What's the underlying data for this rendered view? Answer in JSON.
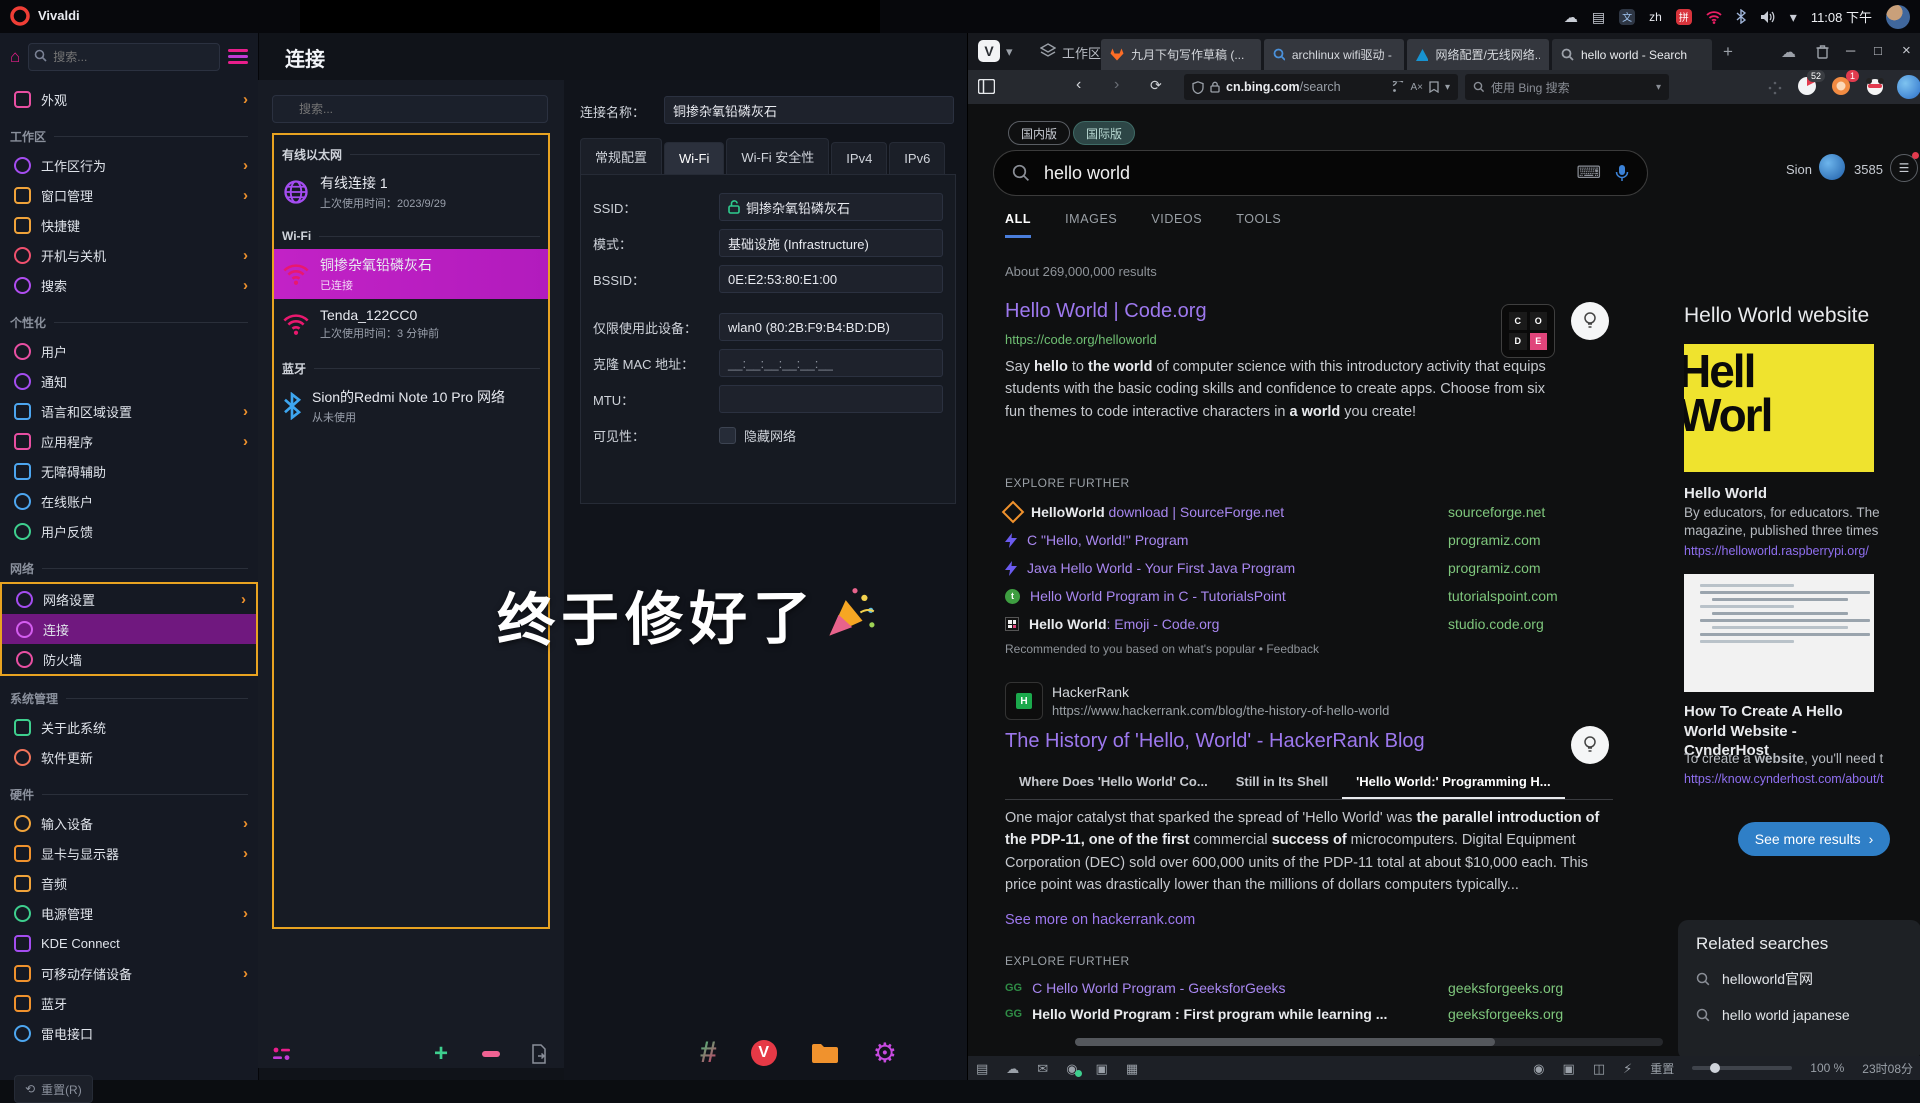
{
  "icons": {
    "chevron": "›",
    "plus": "+",
    "close": "×",
    "maximize": "□",
    "minimize": "─",
    "dropdown": "▾",
    "back": "‹",
    "forward": "›",
    "reload": "⟳",
    "menu": "☰",
    "undo": "⟲",
    "hash": "#",
    "gear": "⚙",
    "keyboard": "⌨",
    "newtab": "+",
    "home": "⌂",
    "mail": "✉",
    "cloud": "☁",
    "panel": "▤",
    "image": "▣",
    "calendar": "▦",
    "tile": "◫",
    "lightning": "⚡",
    "camera": "◉",
    "translate": "A×"
  },
  "topbar": {
    "app_title": "Vivaldi",
    "lang_indicator": "zh",
    "clock": "11:08 下午",
    "ime_badge": "拼",
    "dict_badge": "文"
  },
  "overlay": {
    "text": "终于修好了"
  },
  "settings": {
    "title": "连接",
    "search_placeholder": "搜索...",
    "sidebar": {
      "top": {
        "label": "外观"
      },
      "groups": [
        {
          "title": "工作区",
          "items": [
            {
              "label": "工作区行为"
            },
            {
              "label": "窗口管理"
            },
            {
              "label": "快捷键"
            },
            {
              "label": "开机与关机"
            },
            {
              "label": "搜索"
            }
          ]
        },
        {
          "title": "个性化",
          "items": [
            {
              "label": "用户"
            },
            {
              "label": "通知"
            },
            {
              "label": "语言和区域设置"
            },
            {
              "label": "应用程序"
            },
            {
              "label": "无障碍辅助"
            },
            {
              "label": "在线账户"
            },
            {
              "label": "用户反馈"
            }
          ]
        },
        {
          "title": "网络",
          "items": [
            {
              "label": "网络设置"
            },
            {
              "label": "连接"
            },
            {
              "label": "防火墙"
            }
          ]
        },
        {
          "title": "系统管理",
          "items": [
            {
              "label": "关于此系统"
            },
            {
              "label": "软件更新"
            }
          ]
        },
        {
          "title": "硬件",
          "items": [
            {
              "label": "输入设备"
            },
            {
              "label": "显卡与显示器"
            },
            {
              "label": "音频"
            },
            {
              "label": "电源管理"
            },
            {
              "label": "KDE Connect"
            },
            {
              "label": "可移动存储设备"
            },
            {
              "label": "蓝牙"
            },
            {
              "label": "雷电接口"
            }
          ]
        }
      ]
    },
    "list": {
      "search_placeholder": "搜索...",
      "groups": [
        {
          "title": "有线以太网",
          "items": [
            {
              "name": "有线连接 1",
              "sub": "上次使用时间：2023/9/29"
            }
          ]
        },
        {
          "title": "Wi-Fi",
          "items": [
            {
              "name": "铜掺杂氧铅磷灰石",
              "sub": "已连接"
            },
            {
              "name": "Tenda_122CC0",
              "sub": "上次使用时间：3 分钟前"
            }
          ]
        },
        {
          "title": "蓝牙",
          "items": [
            {
              "name": "Sion的Redmi Note 10 Pro 网络",
              "sub": "从未使用"
            }
          ]
        }
      ],
      "reset_button": "重置(R)"
    },
    "detail": {
      "name_label": "连接名称：",
      "name_value": "铜掺杂氧铅磷灰石",
      "tabs": [
        "常规配置",
        "Wi-Fi",
        "Wi-Fi 安全性",
        "IPv4",
        "IPv6"
      ],
      "ssid_label": "SSID：",
      "ssid_value": "铜掺杂氧铅磷灰石",
      "mode_label": "模式：",
      "mode_value": "基础设施 (Infrastructure)",
      "bssid_label": "BSSID：",
      "bssid_value": "0E:E2:53:80:E1:00",
      "device_label": "仅限使用此设备：",
      "device_value": "wlan0 (80:2B:F9:B4:BD:DB)",
      "mac_label": "克隆 MAC 地址：",
      "mac_value": "__:__:__:__:__:__",
      "mtu_label": "MTU：",
      "visibility_label": "可见性：",
      "visibility_checkbox": "隐藏网络"
    }
  },
  "browser": {
    "workspace_label": "工作区",
    "tabs": [
      {
        "title": "九月下旬写作草稿 (..."
      },
      {
        "title": "archlinux wifi驱动 - ..."
      },
      {
        "title": "网络配置/无线网络..."
      },
      {
        "title": "hello world - Search"
      }
    ],
    "url_host": "cn.bing.com",
    "url_path": "/search",
    "search_placeholder": "使用 Bing 搜索",
    "ext_badge_1": "52",
    "ext_badge_2": "1",
    "status": {
      "reset_zoom": "重置",
      "zoom_level": "100 %",
      "clock": "23时08分"
    }
  },
  "bing": {
    "region_cn": "国内版",
    "region_intl": "国际版",
    "query": "hello world",
    "user_name": "Sion",
    "user_points": "3585",
    "tabs": [
      "ALL",
      "IMAGES",
      "VIDEOS",
      "TOOLS"
    ],
    "results_count": "About 269,000,000 results",
    "r1": {
      "title": "Hello World | Code.org",
      "url": "https://code.org/helloworld",
      "snippet": [
        {
          "t": "Say "
        },
        {
          "t": "hello",
          "b": 1
        },
        {
          "t": " to "
        },
        {
          "t": "the world",
          "b": 1
        },
        {
          "t": " of computer science with this introductory activity that equips students with the basic coding skills and confidence to create apps. Choose from six fun themes to code interactive characters in "
        },
        {
          "t": "a world",
          "b": 1
        },
        {
          "t": " you create!"
        }
      ]
    },
    "explore1": {
      "caption": "EXPLORE FURTHER",
      "rows": [
        {
          "text": [
            {
              "t": "HelloWorld",
              "b": 1
            },
            {
              "t": " download | SourceForge.net"
            }
          ],
          "domain": "sourceforge.net"
        },
        {
          "text": [
            {
              "t": "C \"Hello, World!\" Program"
            }
          ],
          "domain": "programiz.com"
        },
        {
          "text": [
            {
              "t": "Java Hello World - Your First Java Program"
            }
          ],
          "domain": "programiz.com"
        },
        {
          "text": [
            {
              "t": "Hello World Program in C - TutorialsPoint"
            }
          ],
          "domain": "tutorialspoint.com"
        },
        {
          "text": [
            {
              "t": "Hello World",
              "b": 1
            },
            {
              "t": ": Emoji - Code.org"
            }
          ],
          "domain": "studio.code.org"
        }
      ],
      "footer": "Recommended to you based on what's popular • Feedback"
    },
    "hackerrank": {
      "site": "HackerRank",
      "url": "https://www.hackerrank.com/blog/the-history-of-hello-world",
      "title": "The History of 'Hello, World' - HackerRank Blog",
      "tabs": [
        "Where Does 'Hello World' Co...",
        "Still in Its Shell",
        "'Hello World:' Programming H..."
      ],
      "para": [
        {
          "t": "One major catalyst that sparked the spread of 'Hello World' was "
        },
        {
          "t": "the parallel introduction of the PDP-11, one of the first",
          "b": 1
        },
        {
          "t": " commercial "
        },
        {
          "t": "success of",
          "b": 1
        },
        {
          "t": " microcomputers. Digital Equipment Corporation (DEC) sold over 600,000 units of the PDP-11 total at about $10,000 each. This price point was drastically lower than the millions of dollars computers typically..."
        }
      ],
      "more": "See more on hackerrank.com"
    },
    "explore2": {
      "caption": "EXPLORE FURTHER",
      "rows": [
        {
          "text": [
            {
              "t": "C Hello World Program - GeeksforGeeks"
            }
          ],
          "domain": "geeksforgeeks.org"
        },
        {
          "text": [
            {
              "t": "Hello World Program : First program while learning ...",
              "b": 1
            }
          ],
          "domain": "geeksforgeeks.org"
        }
      ]
    },
    "side": {
      "title": "Hello World website",
      "img1_line1": "Hell",
      "img1_line2": "Worl",
      "h1": "Hello World",
      "d1": "By educators, for educators. The magazine, published three times",
      "l1": "https://helloworld.raspberrypi.org/",
      "h2": "How To Create A Hello World Website - CynderHost",
      "d2": [
        {
          "t": "To create a "
        },
        {
          "t": "website",
          "b": 1
        },
        {
          "t": ", you'll need t"
        }
      ],
      "l2": "https://know.cynderhost.com/about/t",
      "more_button": "See more results",
      "related_title": "Related searches",
      "related": [
        "helloworld官网",
        "hello world japanese"
      ]
    }
  },
  "taskbar": {}
}
